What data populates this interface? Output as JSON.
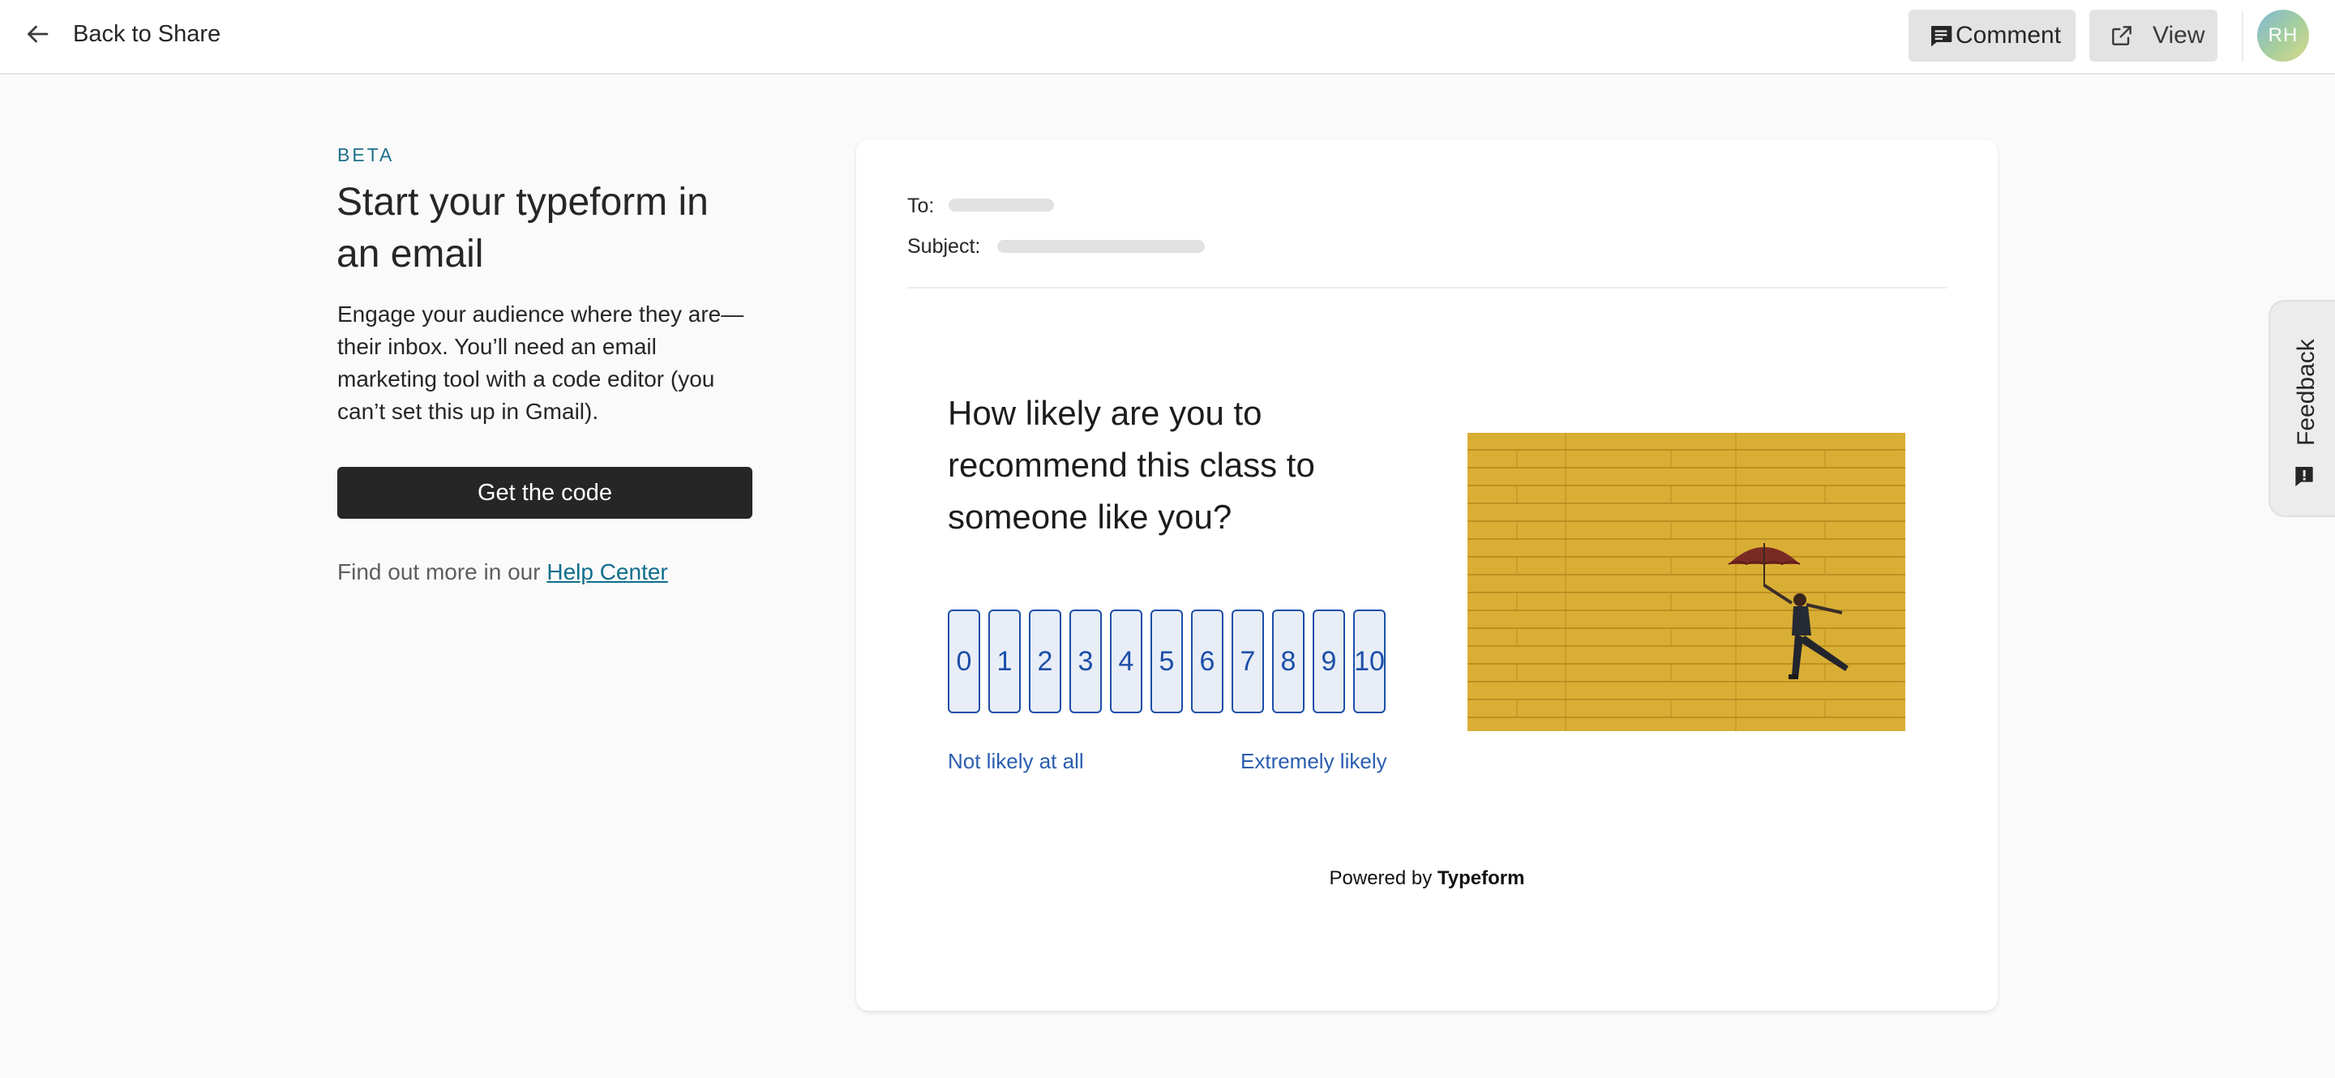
{
  "header": {
    "back_label": "Back to Share",
    "comment_label": "Comment",
    "view_label": "View",
    "avatar_initials": "RH"
  },
  "intro": {
    "badge": "BETA",
    "title": "Start your typeform in an email",
    "description": "Engage your audience where they are—their inbox. You’ll need an email marketing tool with a code editor (you can’t set this up in Gmail).",
    "cta_label": "Get the code",
    "help_prefix": "Find out more in our ",
    "help_link": "Help Center"
  },
  "email_preview": {
    "to_label": "To:",
    "subject_label": "Subject:",
    "question": "How likely are you to recommend this class to someone like you?",
    "scale": [
      "0",
      "1",
      "2",
      "3",
      "4",
      "5",
      "6",
      "7",
      "8",
      "9",
      "10"
    ],
    "scale_low_label": "Not likely at all",
    "scale_high_label": "Extremely likely",
    "powered_prefix": "Powered by ",
    "powered_brand": "Typeform"
  },
  "feedback_tab": {
    "label": "Feedback"
  },
  "colors": {
    "accent_blue": "#1c4fa8",
    "link_teal": "#0f6e8c",
    "cta_dark": "#262627",
    "photo_yellow": "#d6a82e"
  }
}
